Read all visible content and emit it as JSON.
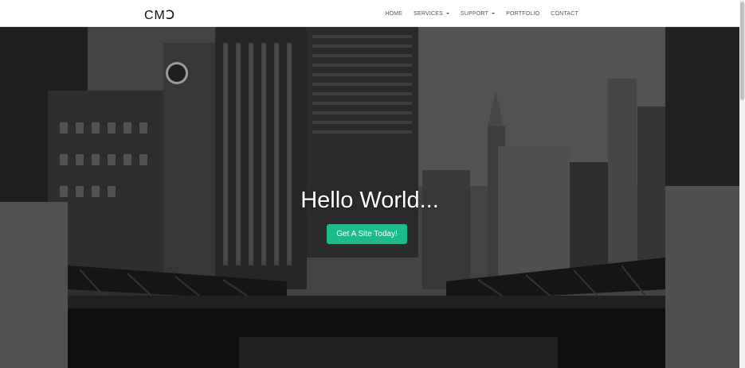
{
  "brand": {
    "logo_text": "CMↃ"
  },
  "nav": {
    "items": [
      {
        "label": "HOME",
        "dropdown": false
      },
      {
        "label": "SERVICES",
        "dropdown": true
      },
      {
        "label": "SUPPORT",
        "dropdown": true
      },
      {
        "label": "PORTFOLIO",
        "dropdown": false
      },
      {
        "label": "CONTACT",
        "dropdown": false
      }
    ]
  },
  "hero": {
    "title": "Hello World...",
    "cta_label": "Get A Site Today!",
    "background_description": "black-and-white city skyline with river and bridge",
    "accent_color": "#1abc8c"
  }
}
